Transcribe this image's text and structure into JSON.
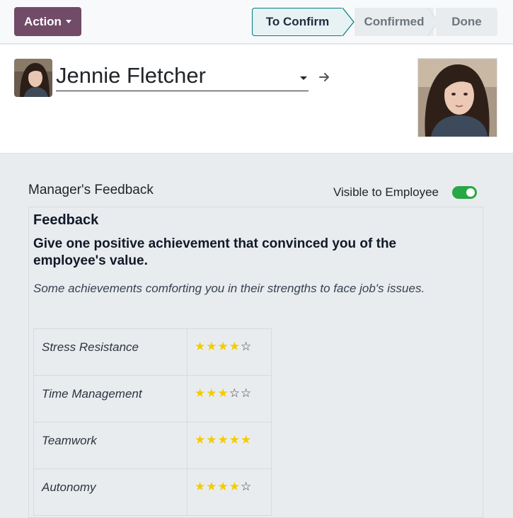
{
  "toolbar": {
    "action_label": "Action"
  },
  "status_stages": [
    {
      "label": "To Confirm",
      "active": true
    },
    {
      "label": "Confirmed",
      "active": false
    },
    {
      "label": "Done",
      "active": false
    }
  ],
  "employee": {
    "name": "Jennie Fletcher"
  },
  "feedback_section": {
    "title": "Manager's Feedback",
    "visible_label": "Visible to Employee",
    "visible_to_employee": true,
    "heading": "Feedback",
    "question": "Give one positive achievement that convinced you of the employee's value.",
    "hint": "Some achievements comforting you in their strengths to face job's issues.",
    "ratings": [
      {
        "criterion": "Stress Resistance",
        "stars": 4,
        "max": 5
      },
      {
        "criterion": "Time Management",
        "stars": 3,
        "max": 5
      },
      {
        "criterion": "Teamwork",
        "stars": 5,
        "max": 5
      },
      {
        "criterion": "Autonomy",
        "stars": 4,
        "max": 5
      }
    ]
  },
  "colors": {
    "action_button": "#714b67",
    "status_active_border": "#017e84",
    "status_active_bg": "#e6f2f3",
    "toggle_on": "#28a745",
    "star_full": "#f3cc00"
  },
  "icons": {
    "action_caret": "caret-down-icon",
    "name_dropdown": "caret-down-icon",
    "name_link": "arrow-right-icon",
    "star_full": "star-filled-icon",
    "star_empty": "star-outline-icon"
  }
}
